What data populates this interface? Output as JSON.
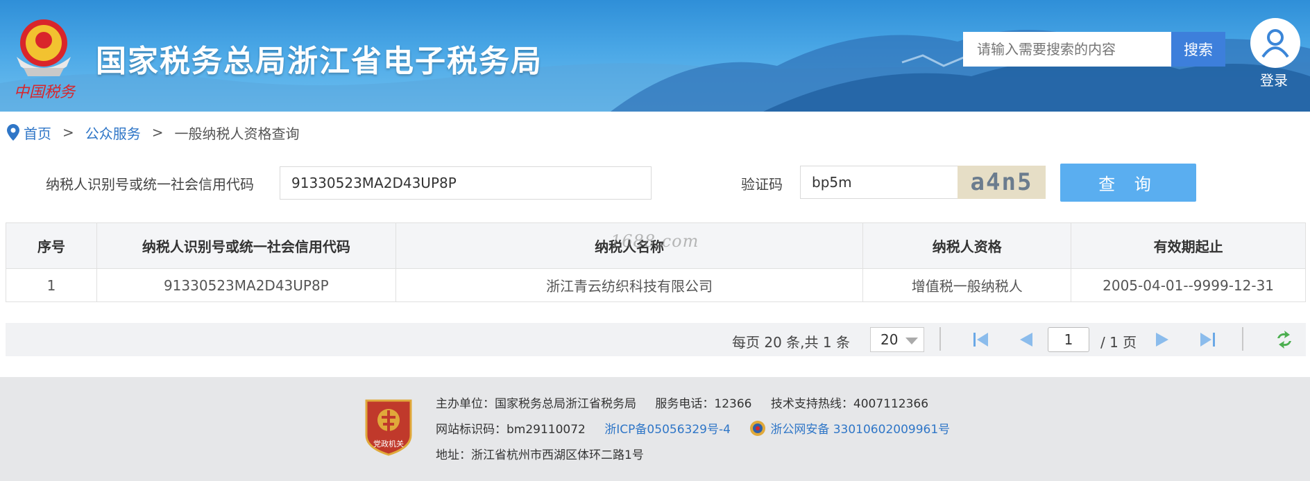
{
  "header": {
    "site_title": "国家税务总局浙江省电子税务局",
    "emblem_caption": "中国税务",
    "search_placeholder": "请输入需要搜索的内容",
    "search_button": "搜索",
    "login_label": "登录"
  },
  "breadcrumb": {
    "home": "首页",
    "section": "公众服务",
    "current": "一般纳税人资格查询",
    "separator": ">"
  },
  "query_form": {
    "taxpayer_id_label": "纳税人识别号或统一社会信用代码",
    "taxpayer_id_value": "91330523MA2D43UP8P",
    "captcha_label": "验证码",
    "captcha_value": "bp5m",
    "captcha_image_text": "a4n5",
    "query_button": "查 询"
  },
  "results_table": {
    "columns": [
      "序号",
      "纳税人识别号或统一社会信用代码",
      "纳税人名称",
      "纳税人资格",
      "有效期起止"
    ],
    "rows": [
      [
        "1",
        "91330523MA2D43UP8P",
        "浙江青云纺织科技有限公司",
        "增值税一般纳税人",
        "2005-04-01--9999-12-31"
      ]
    ],
    "watermark": "1688.com"
  },
  "pagination": {
    "info": "每页 20 条,共 1 条",
    "page_size": "20",
    "current_page": "1",
    "total_pages": "/ 1 页"
  },
  "footer": {
    "sponsor": "主办单位：国家税务总局浙江省税务局",
    "service_phone": "服务电话：12366",
    "tech_hotline": "技术支持热线：4007112366",
    "site_code": "网站标识码：bm29110072",
    "icp": "浙ICP备05056329号-4",
    "police_record": "浙公网安备 33010602009961号",
    "address": "地址：浙江省杭州市西湖区体环二路1号",
    "badge_text": "党政机关"
  },
  "colors": {
    "link_blue": "#2f76c7",
    "search_button": "#3d7fdb",
    "query_button": "#5aaef0"
  }
}
